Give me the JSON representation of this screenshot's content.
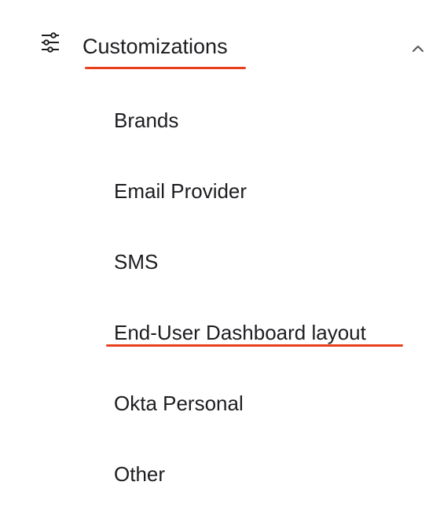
{
  "section": {
    "title": "Customizations",
    "icon": "sliders-icon",
    "expanded_icon": "chevron-up-icon",
    "highlight_color": "#e8401c"
  },
  "submenu": {
    "items": [
      {
        "label": "Brands"
      },
      {
        "label": "Email Provider"
      },
      {
        "label": "SMS"
      },
      {
        "label": "End-User Dashboard layout"
      },
      {
        "label": "Okta Personal"
      },
      {
        "label": "Other"
      }
    ]
  }
}
